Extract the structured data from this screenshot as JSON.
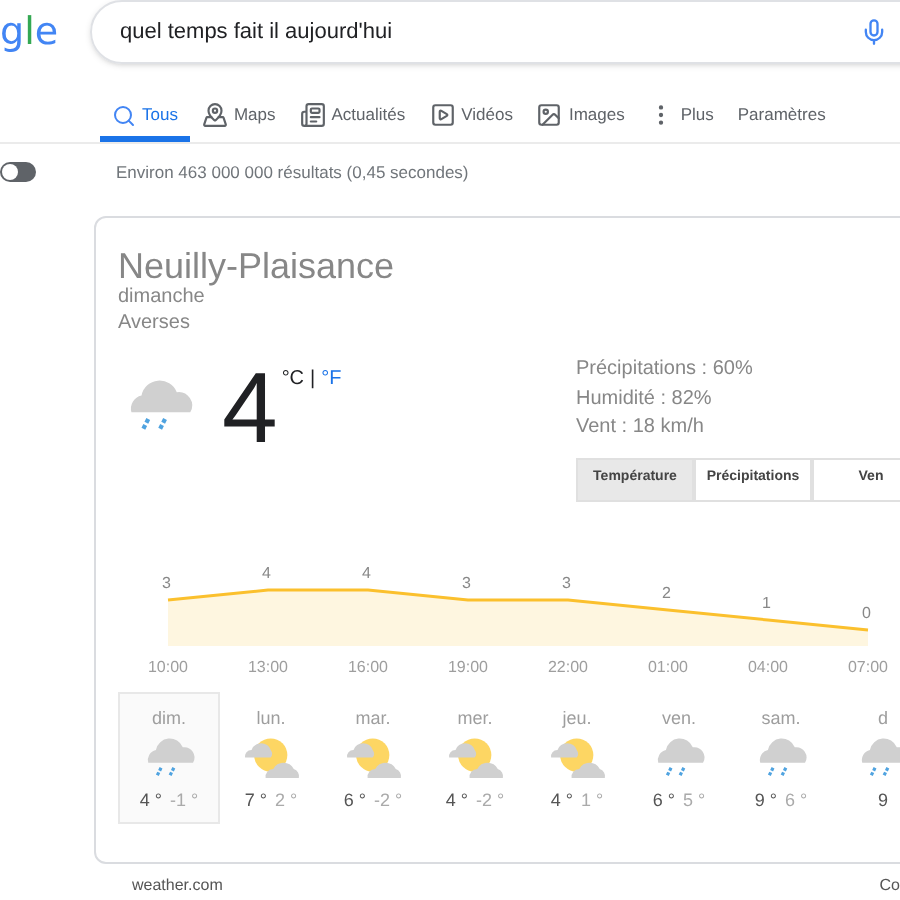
{
  "logo": "gle",
  "search": {
    "value": "quel temps fait il aujourd'hui"
  },
  "tabs": [
    {
      "label": "Tous",
      "kind": "all",
      "selected": true
    },
    {
      "label": "Maps",
      "kind": "maps",
      "selected": false
    },
    {
      "label": "Actualités",
      "kind": "news",
      "selected": false
    },
    {
      "label": "Vidéos",
      "kind": "videos",
      "selected": false
    },
    {
      "label": "Images",
      "kind": "images",
      "selected": false
    },
    {
      "label": "Plus",
      "kind": "more",
      "selected": false
    },
    {
      "label": "Paramètres",
      "kind": "settings",
      "selected": false
    }
  ],
  "safesearch_toggle": {
    "on": false
  },
  "result_stats": "Environ 463 000 000 résultats (0,45 secondes)",
  "weather": {
    "location": "Neuilly-Plaisance",
    "day": "dimanche",
    "condition": "Averses",
    "temperature": "4",
    "unit_c": "°C",
    "separator": "|",
    "unit_f": "°F",
    "details": [
      "Précipitations : 60%",
      "Humidité : 82%",
      "Vent : 18 km/h"
    ],
    "chart_tabs": [
      {
        "label": "Température",
        "selected": true
      },
      {
        "label": "Précipitations",
        "selected": false
      },
      {
        "label": "Ven",
        "selected": false
      }
    ],
    "chart_data": {
      "type": "area",
      "categories": [
        "10:00",
        "13:00",
        "16:00",
        "19:00",
        "22:00",
        "01:00",
        "04:00",
        "07:00"
      ],
      "series": [
        {
          "color": "#fbc02d",
          "values": [
            3,
            4,
            4,
            3,
            3,
            2,
            1,
            0
          ]
        }
      ],
      "data_labels": true
    },
    "days": [
      {
        "day": "dim.",
        "kind": "rain",
        "high": "4 °",
        "low": "-1 °",
        "selected": true
      },
      {
        "day": "lun.",
        "kind": "partly_cloudy",
        "high": "7 °",
        "low": "2 °",
        "selected": false
      },
      {
        "day": "mar.",
        "kind": "partly_cloudy",
        "high": "6 °",
        "low": "-2 °",
        "selected": false
      },
      {
        "day": "mer.",
        "kind": "partly_cloudy",
        "high": "4 °",
        "low": "-2 °",
        "selected": false
      },
      {
        "day": "jeu.",
        "kind": "partly_cloudy",
        "high": "4 °",
        "low": "1 °",
        "selected": false
      },
      {
        "day": "ven.",
        "kind": "rain",
        "high": "6 °",
        "low": "5 °",
        "selected": false
      },
      {
        "day": "sam.",
        "kind": "rain",
        "high": "9 °",
        "low": "6 °",
        "selected": false
      },
      {
        "day": "d",
        "kind": "rain",
        "high": "9",
        "selected": false
      }
    ],
    "source": "weather.com",
    "footer_right": "Co"
  }
}
